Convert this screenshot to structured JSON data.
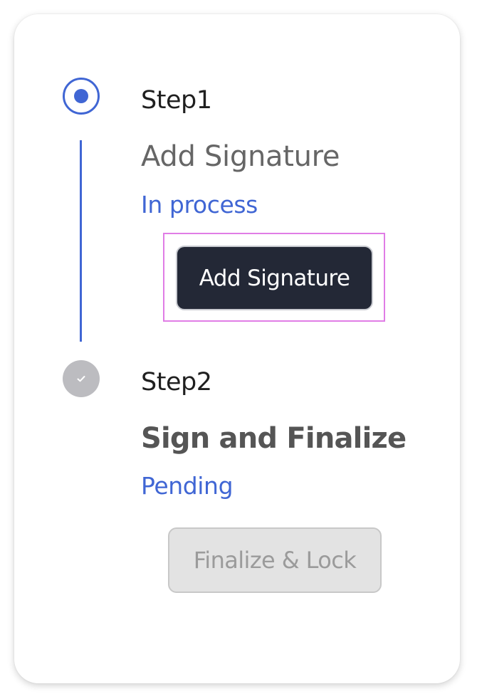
{
  "steps": [
    {
      "label": "Step1",
      "title": "Add Signature",
      "status": "In process",
      "button_label": "Add Signature",
      "indicator": "radio-active-icon"
    },
    {
      "label": "Step2",
      "title": "Sign and Finalize",
      "status": "Pending",
      "button_label": "Finalize & Lock",
      "indicator": "check-icon"
    }
  ],
  "colors": {
    "accent": "#4066d4",
    "primary_button_bg": "#232836",
    "disabled_button_bg": "#e3e3e3",
    "focus_outline": "#e07de6",
    "completed_indicator": "#bcbcc0"
  }
}
